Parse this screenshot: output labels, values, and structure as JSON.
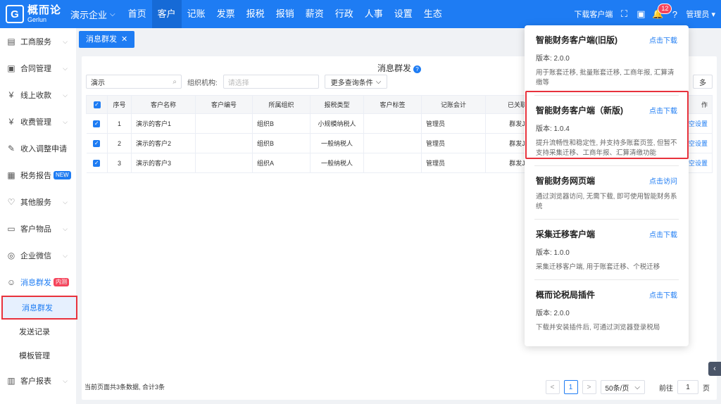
{
  "brand": {
    "mark": "G",
    "name_cn": "概而论",
    "name_en": "Gerlun"
  },
  "company": {
    "label": "演示企业",
    "caret": "⌵"
  },
  "nav": [
    {
      "label": "首页"
    },
    {
      "label": "客户",
      "active": true
    },
    {
      "label": "记账"
    },
    {
      "label": "发票"
    },
    {
      "label": "报税"
    },
    {
      "label": "报销"
    },
    {
      "label": "薪资"
    },
    {
      "label": "行政"
    },
    {
      "label": "人事"
    },
    {
      "label": "设置"
    },
    {
      "label": "生态"
    }
  ],
  "topright": {
    "download": "下载客户端",
    "notify_count": "12",
    "user": "管理员"
  },
  "sidebar": {
    "items": [
      {
        "label": "工商服务",
        "icon": "id-card-icon",
        "glyph": "▤"
      },
      {
        "label": "合同管理",
        "icon": "contract-icon",
        "glyph": "▣"
      },
      {
        "label": "线上收款",
        "icon": "payment-icon",
        "glyph": "¥"
      },
      {
        "label": "收费管理",
        "icon": "fee-icon",
        "glyph": "¥"
      },
      {
        "label": "收入调整申请",
        "icon": "form-icon",
        "glyph": "✎"
      },
      {
        "label": "税务报告",
        "icon": "report-icon",
        "glyph": "▦",
        "tag": "NEW"
      },
      {
        "label": "其他服务",
        "icon": "heart-icon",
        "glyph": "♡"
      },
      {
        "label": "客户物品",
        "icon": "box-icon",
        "glyph": "▭"
      },
      {
        "label": "企业微信",
        "icon": "chat-icon",
        "glyph": "◎"
      }
    ],
    "group": {
      "label": "消息群发",
      "icon": "robot-icon",
      "glyph": "☺",
      "tag": "内测"
    },
    "sub": [
      {
        "label": "消息群发",
        "active": true
      },
      {
        "label": "发送记录"
      },
      {
        "label": "模板管理"
      }
    ],
    "last": {
      "label": "客户报表",
      "icon": "chart-icon",
      "glyph": "▥"
    }
  },
  "tab": {
    "label": "消息群发",
    "close": "✕"
  },
  "main": {
    "title": "消息群发",
    "search_value": "演示",
    "org_label": "组织机构:",
    "org_placeholder": "请选择",
    "more_query": "更多查询条件",
    "more_right": "多"
  },
  "table": {
    "headers": [
      "序号",
      "客户名称",
      "客户编号",
      "所属组织",
      "报税类型",
      "客户标签",
      "记账会计",
      "已关联",
      "作"
    ],
    "rows": [
      {
        "no": "1",
        "name": "演示的客户1",
        "code": "",
        "org": "组织B",
        "tax": "小规模纳税人",
        "tag": "",
        "acct": "管理员",
        "linked": "群发J",
        "op": "空设置"
      },
      {
        "no": "2",
        "name": "演示的客户2",
        "code": "",
        "org": "组织B",
        "tax": "一般纳税人",
        "tag": "",
        "acct": "管理员",
        "linked": "群发J",
        "op": "空设置"
      },
      {
        "no": "3",
        "name": "演示的客户3",
        "code": "",
        "org": "组织A",
        "tax": "一般纳税人",
        "tag": "",
        "acct": "管理员",
        "linked": "群发J",
        "op": "空设置"
      }
    ]
  },
  "footer": {
    "summary": "当前页面共3条数据, 合计3条",
    "prev": "<",
    "page": "1",
    "next": ">",
    "page_size": "50条/页",
    "goto_label": "前往",
    "goto_value": "1",
    "goto_unit": "页"
  },
  "popover": {
    "items": [
      {
        "title": "智能财务客户端(旧版)",
        "action": "点击下载",
        "version": "版本: 2.0.0",
        "desc": "用于账套迁移, 批量账套迁移, 工商年报, 汇算清缴等"
      },
      {
        "title": "智能财务客户端（新版)",
        "action": "点击下载",
        "version": "版本: 1.0.4",
        "desc": "提升流畅性和稳定性, 并支持多账套页签, 但暂不支持采集迁移、工商年报、汇算清缴功能"
      },
      {
        "title": "智能财务网页端",
        "action": "点击访问",
        "version": "",
        "desc": "通过浏览器访问, 无需下载, 即可使用智能财务系统"
      },
      {
        "title": "采集迁移客户端",
        "action": "点击下载",
        "version": "版本: 1.0.0",
        "desc": "采集迁移客户端, 用于账套迁移、个税迁移"
      },
      {
        "title": "概而论税局插件",
        "action": "点击下载",
        "version": "版本: 2.0.0",
        "desc": "下载并安装插件后, 可通过浏览器登录税局"
      }
    ]
  },
  "colors": {
    "primary": "#1e7cf3",
    "highlight": "#e8323c"
  }
}
